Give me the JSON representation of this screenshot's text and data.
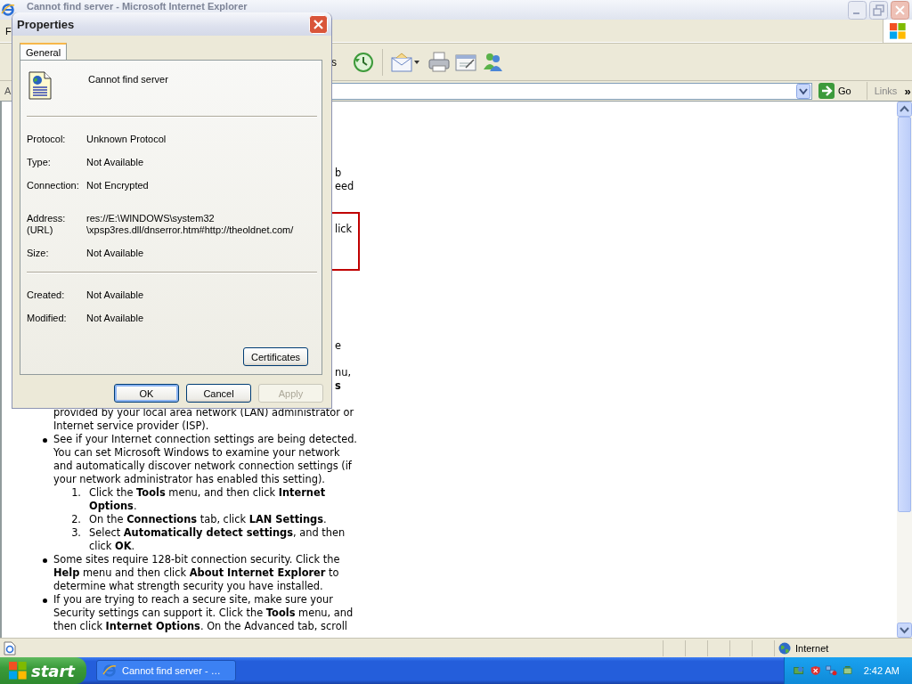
{
  "browser": {
    "title": "Cannot find server - Microsoft Internet Explorer",
    "menu_fragment": "F",
    "toolbar_fragment": "s",
    "address_fragment": "A",
    "go_label": "Go",
    "links_label": "Links",
    "links_chevron": "»"
  },
  "page": {
    "fragments": [
      {
        "text": "b",
        "bold": false,
        "kind": "line"
      },
      {
        "text": "eed",
        "bold": false,
        "kind": "line"
      },
      {
        "text": "lick",
        "bold": false,
        "kind": "boxed"
      },
      {
        "text": "e",
        "bold": false,
        "kind": "line"
      },
      {
        "text": "nu,",
        "bold": false,
        "kind": "line"
      },
      {
        "text": "s",
        "bold": true,
        "kind": "line"
      }
    ],
    "list": [
      {
        "kind": "continuation",
        "text": "provided by your local area network (LAN) administrator or Internet service provider (ISP)."
      },
      {
        "kind": "bullet",
        "text": "See if your Internet connection settings are being detected. You can set Microsoft Windows to examine your network and automatically discover network connection settings (if your network administrator has enabled this setting).",
        "children": [
          {
            "number": "1.",
            "text": "Click the **Tools** menu, and then click **Internet Options**."
          },
          {
            "number": "2.",
            "text": "On the **Connections** tab, click **LAN Settings**."
          },
          {
            "number": "3.",
            "text": "Select **Automatically detect settings**, and then click **OK**."
          }
        ]
      },
      {
        "kind": "bullet",
        "text": "Some sites require 128-bit connection security. Click the **Help** menu and then click **About Internet Explorer** to determine what strength security you have installed."
      },
      {
        "kind": "bullet",
        "text": "If you are trying to reach a secure site, make sure your Security settings can support it. Click the **Tools** menu, and then click **Internet Options**. On the Advanced tab, scroll"
      }
    ]
  },
  "status_bar": {
    "zone": "Internet"
  },
  "dialog": {
    "title": "Properties",
    "tabs": [
      {
        "label": "General",
        "selected": true
      }
    ],
    "file_name": "Cannot find server",
    "groups": [
      {
        "rows": [
          {
            "kind": "single",
            "label": "Protocol:",
            "value": "Unknown Protocol"
          },
          {
            "kind": "single",
            "label": "Type:",
            "value": "Not Available"
          },
          {
            "kind": "single",
            "label": "Connection:",
            "value": "Not Encrypted"
          },
          {
            "kind": "multiline",
            "label": "Address:\n(URL)",
            "value": "res://E:\\WINDOWS\\system32\n\\xpsp3res.dll/dnserror.htm#http://theoldnet.com/"
          },
          {
            "kind": "single",
            "label": "Size:",
            "value": "Not Available"
          }
        ]
      },
      {
        "rows": [
          {
            "kind": "single",
            "label": "Created:",
            "value": "Not Available"
          },
          {
            "kind": "single",
            "label": "Modified:",
            "value": "Not Available"
          }
        ]
      }
    ],
    "certificates_label": "Certificates",
    "buttons": [
      {
        "label": "OK",
        "default": true,
        "disabled": false
      },
      {
        "label": "Cancel",
        "default": false,
        "disabled": false
      },
      {
        "label": "Apply",
        "default": false,
        "disabled": true
      }
    ]
  },
  "taskbar": {
    "start_label": "start",
    "tasks": [
      {
        "label": "Cannot find server - …",
        "selected": false
      }
    ],
    "clock": "2:42 AM"
  }
}
